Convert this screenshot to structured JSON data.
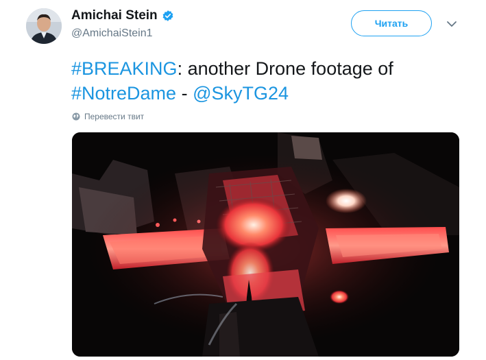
{
  "author": {
    "display_name": "Amichai Stein",
    "handle": "@AmichaiStein1",
    "verified": true,
    "avatar_icon": "user-photo"
  },
  "actions": {
    "follow_label": "Читать",
    "more_icon": "chevron-down-icon"
  },
  "tweet": {
    "segments": [
      {
        "type": "hashtag",
        "text": "#BREAKING"
      },
      {
        "type": "text",
        "text": ": another Drone footage of "
      },
      {
        "type": "hashtag",
        "text": "#NotreDame"
      },
      {
        "type": "text",
        "text": " - "
      },
      {
        "type": "mention",
        "text": "@SkyTG24"
      }
    ],
    "translate_label": "Перевести твит"
  },
  "colors": {
    "link": "#1b95e0",
    "accent": "#1da1f2",
    "secondary_text": "#657786"
  }
}
